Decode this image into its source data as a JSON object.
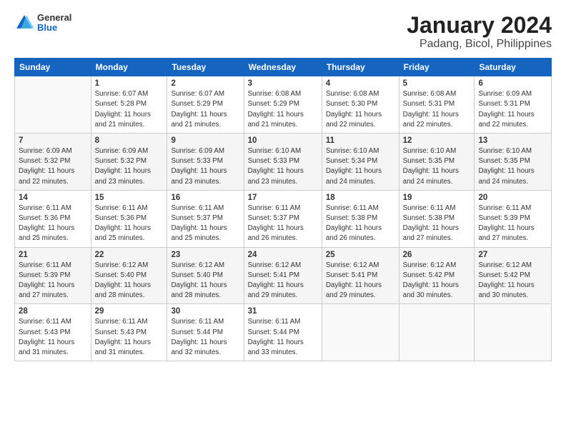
{
  "header": {
    "logo": {
      "line1": "General",
      "line2": "Blue"
    },
    "title": "January 2024",
    "subtitle": "Padang, Bicol, Philippines"
  },
  "days_of_week": [
    "Sunday",
    "Monday",
    "Tuesday",
    "Wednesday",
    "Thursday",
    "Friday",
    "Saturday"
  ],
  "weeks": [
    [
      {
        "day": "",
        "info": ""
      },
      {
        "day": "1",
        "info": "Sunrise: 6:07 AM\nSunset: 5:28 PM\nDaylight: 11 hours\nand 21 minutes."
      },
      {
        "day": "2",
        "info": "Sunrise: 6:07 AM\nSunset: 5:29 PM\nDaylight: 11 hours\nand 21 minutes."
      },
      {
        "day": "3",
        "info": "Sunrise: 6:08 AM\nSunset: 5:29 PM\nDaylight: 11 hours\nand 21 minutes."
      },
      {
        "day": "4",
        "info": "Sunrise: 6:08 AM\nSunset: 5:30 PM\nDaylight: 11 hours\nand 22 minutes."
      },
      {
        "day": "5",
        "info": "Sunrise: 6:08 AM\nSunset: 5:31 PM\nDaylight: 11 hours\nand 22 minutes."
      },
      {
        "day": "6",
        "info": "Sunrise: 6:09 AM\nSunset: 5:31 PM\nDaylight: 11 hours\nand 22 minutes."
      }
    ],
    [
      {
        "day": "7",
        "info": "Sunrise: 6:09 AM\nSunset: 5:32 PM\nDaylight: 11 hours\nand 22 minutes."
      },
      {
        "day": "8",
        "info": "Sunrise: 6:09 AM\nSunset: 5:32 PM\nDaylight: 11 hours\nand 23 minutes."
      },
      {
        "day": "9",
        "info": "Sunrise: 6:09 AM\nSunset: 5:33 PM\nDaylight: 11 hours\nand 23 minutes."
      },
      {
        "day": "10",
        "info": "Sunrise: 6:10 AM\nSunset: 5:33 PM\nDaylight: 11 hours\nand 23 minutes."
      },
      {
        "day": "11",
        "info": "Sunrise: 6:10 AM\nSunset: 5:34 PM\nDaylight: 11 hours\nand 24 minutes."
      },
      {
        "day": "12",
        "info": "Sunrise: 6:10 AM\nSunset: 5:35 PM\nDaylight: 11 hours\nand 24 minutes."
      },
      {
        "day": "13",
        "info": "Sunrise: 6:10 AM\nSunset: 5:35 PM\nDaylight: 11 hours\nand 24 minutes."
      }
    ],
    [
      {
        "day": "14",
        "info": "Sunrise: 6:11 AM\nSunset: 5:36 PM\nDaylight: 11 hours\nand 25 minutes."
      },
      {
        "day": "15",
        "info": "Sunrise: 6:11 AM\nSunset: 5:36 PM\nDaylight: 11 hours\nand 25 minutes."
      },
      {
        "day": "16",
        "info": "Sunrise: 6:11 AM\nSunset: 5:37 PM\nDaylight: 11 hours\nand 25 minutes."
      },
      {
        "day": "17",
        "info": "Sunrise: 6:11 AM\nSunset: 5:37 PM\nDaylight: 11 hours\nand 26 minutes."
      },
      {
        "day": "18",
        "info": "Sunrise: 6:11 AM\nSunset: 5:38 PM\nDaylight: 11 hours\nand 26 minutes."
      },
      {
        "day": "19",
        "info": "Sunrise: 6:11 AM\nSunset: 5:38 PM\nDaylight: 11 hours\nand 27 minutes."
      },
      {
        "day": "20",
        "info": "Sunrise: 6:11 AM\nSunset: 5:39 PM\nDaylight: 11 hours\nand 27 minutes."
      }
    ],
    [
      {
        "day": "21",
        "info": "Sunrise: 6:11 AM\nSunset: 5:39 PM\nDaylight: 11 hours\nand 27 minutes."
      },
      {
        "day": "22",
        "info": "Sunrise: 6:12 AM\nSunset: 5:40 PM\nDaylight: 11 hours\nand 28 minutes."
      },
      {
        "day": "23",
        "info": "Sunrise: 6:12 AM\nSunset: 5:40 PM\nDaylight: 11 hours\nand 28 minutes."
      },
      {
        "day": "24",
        "info": "Sunrise: 6:12 AM\nSunset: 5:41 PM\nDaylight: 11 hours\nand 29 minutes."
      },
      {
        "day": "25",
        "info": "Sunrise: 6:12 AM\nSunset: 5:41 PM\nDaylight: 11 hours\nand 29 minutes."
      },
      {
        "day": "26",
        "info": "Sunrise: 6:12 AM\nSunset: 5:42 PM\nDaylight: 11 hours\nand 30 minutes."
      },
      {
        "day": "27",
        "info": "Sunrise: 6:12 AM\nSunset: 5:42 PM\nDaylight: 11 hours\nand 30 minutes."
      }
    ],
    [
      {
        "day": "28",
        "info": "Sunrise: 6:11 AM\nSunset: 5:43 PM\nDaylight: 11 hours\nand 31 minutes."
      },
      {
        "day": "29",
        "info": "Sunrise: 6:11 AM\nSunset: 5:43 PM\nDaylight: 11 hours\nand 31 minutes."
      },
      {
        "day": "30",
        "info": "Sunrise: 6:11 AM\nSunset: 5:44 PM\nDaylight: 11 hours\nand 32 minutes."
      },
      {
        "day": "31",
        "info": "Sunrise: 6:11 AM\nSunset: 5:44 PM\nDaylight: 11 hours\nand 33 minutes."
      },
      {
        "day": "",
        "info": ""
      },
      {
        "day": "",
        "info": ""
      },
      {
        "day": "",
        "info": ""
      }
    ]
  ],
  "colors": {
    "header_bg": "#1565c0",
    "header_text": "#ffffff",
    "border": "#cccccc",
    "row_even": "#f5f5f5",
    "row_odd": "#ffffff"
  }
}
